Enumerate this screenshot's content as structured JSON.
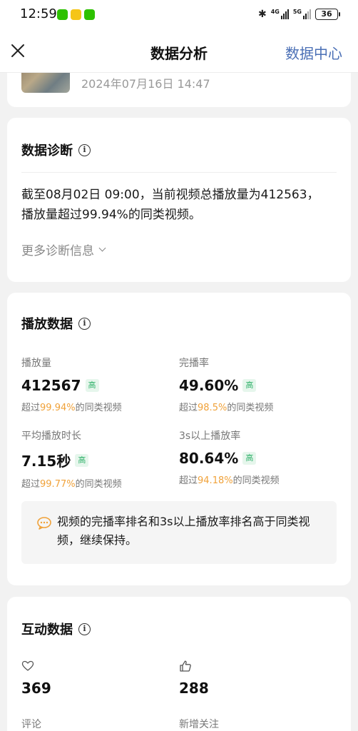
{
  "status_bar": {
    "time": "12:59",
    "net_4g": "4G",
    "net_5g": "5G",
    "battery": "36"
  },
  "nav": {
    "title": "数据分析",
    "right_link": "数据中心"
  },
  "video": {
    "publish_time": "2024年07月16日 14:47"
  },
  "diagnosis": {
    "title": "数据诊断",
    "text": "截至08月02日 09:00，当前视频总播放量为412563，播放量超过99.94%的同类视频。",
    "more": "更多诊断信息"
  },
  "playback": {
    "title": "播放数据",
    "metrics": [
      {
        "label": "播放量",
        "value": "412567",
        "badge": "高",
        "sub_prefix": "超过",
        "sub_pct": "99.94%",
        "sub_suffix": "的同类视频"
      },
      {
        "label": "完播率",
        "value": "49.60%",
        "badge": "高",
        "sub_prefix": "超过",
        "sub_pct": "98.5%",
        "sub_suffix": "的同类视频"
      },
      {
        "label": "平均播放时长",
        "value": "7.15秒",
        "badge": "高",
        "sub_prefix": "超过",
        "sub_pct": "99.77%",
        "sub_suffix": "的同类视频"
      },
      {
        "label": "3s以上播放率",
        "value": "80.64%",
        "badge": "高",
        "sub_prefix": "超过",
        "sub_pct": "94.18%",
        "sub_suffix": "的同类视频"
      }
    ],
    "tip": "视频的完播率排名和3s以上播放率排名高于同类视频，继续保持。"
  },
  "interaction": {
    "title": "互动数据",
    "items": [
      {
        "icon": "heart-icon",
        "value": "369"
      },
      {
        "icon": "thumbs-up-icon",
        "value": "288"
      }
    ],
    "labels": [
      "评论",
      "新增关注"
    ]
  },
  "colors": {
    "accent_link": "#4a6fb5",
    "highlight": "#f0a23a",
    "badge_green": "#2fb26a"
  }
}
